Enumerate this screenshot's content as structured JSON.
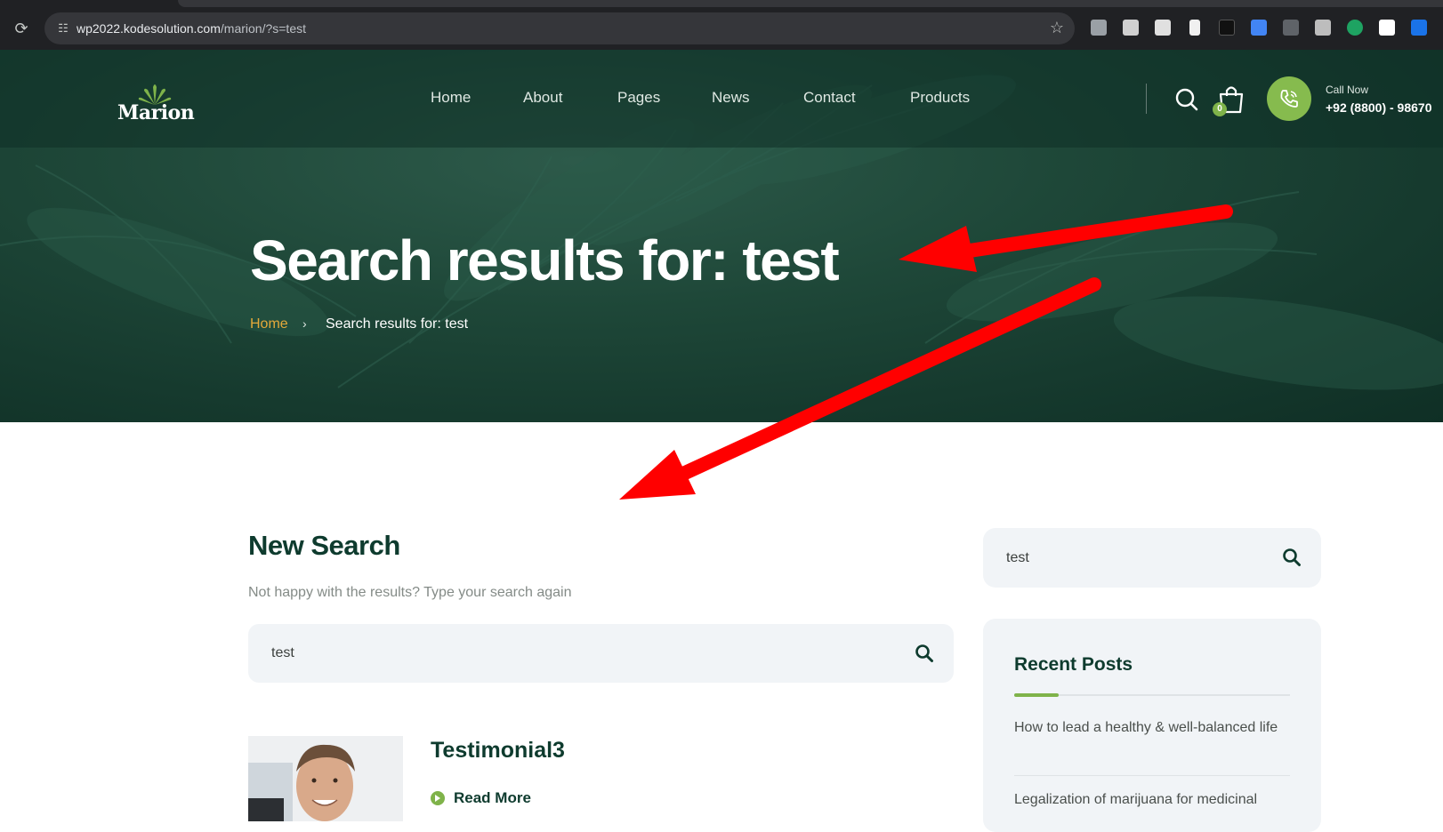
{
  "browser": {
    "url_host": "wp2022.kodesolution.com",
    "url_path": "/marion/?s=test"
  },
  "site": {
    "logo_text": "Marion",
    "nav": [
      "Home",
      "About",
      "Pages",
      "News",
      "Contact",
      "Products"
    ],
    "cart_count": "0",
    "call_label": "Call Now",
    "call_number": "+92 (8800) - 98670"
  },
  "hero": {
    "title": "Search results for: test",
    "breadcrumb_home": "Home",
    "breadcrumb_separator": "›",
    "breadcrumb_current": "Search results for: test"
  },
  "main": {
    "title": "New Search",
    "subtitle": "Not happy with the results? Type your search again",
    "search_value": "test",
    "results": [
      {
        "title": "Testimonial3",
        "link_label": "Read More"
      }
    ]
  },
  "sidebar": {
    "search_value": "test",
    "recent_heading": "Recent Posts",
    "recent_posts": [
      "How to lead a healthy & well-balanced life",
      "Legalization of marijuana for medicinal"
    ]
  },
  "colors": {
    "hero_green": "#163a2e",
    "accent_green": "#7fb34a",
    "accent_orange": "#e4a93a",
    "annotation_red": "#ff0000",
    "heading_green": "#0e3b2e"
  }
}
